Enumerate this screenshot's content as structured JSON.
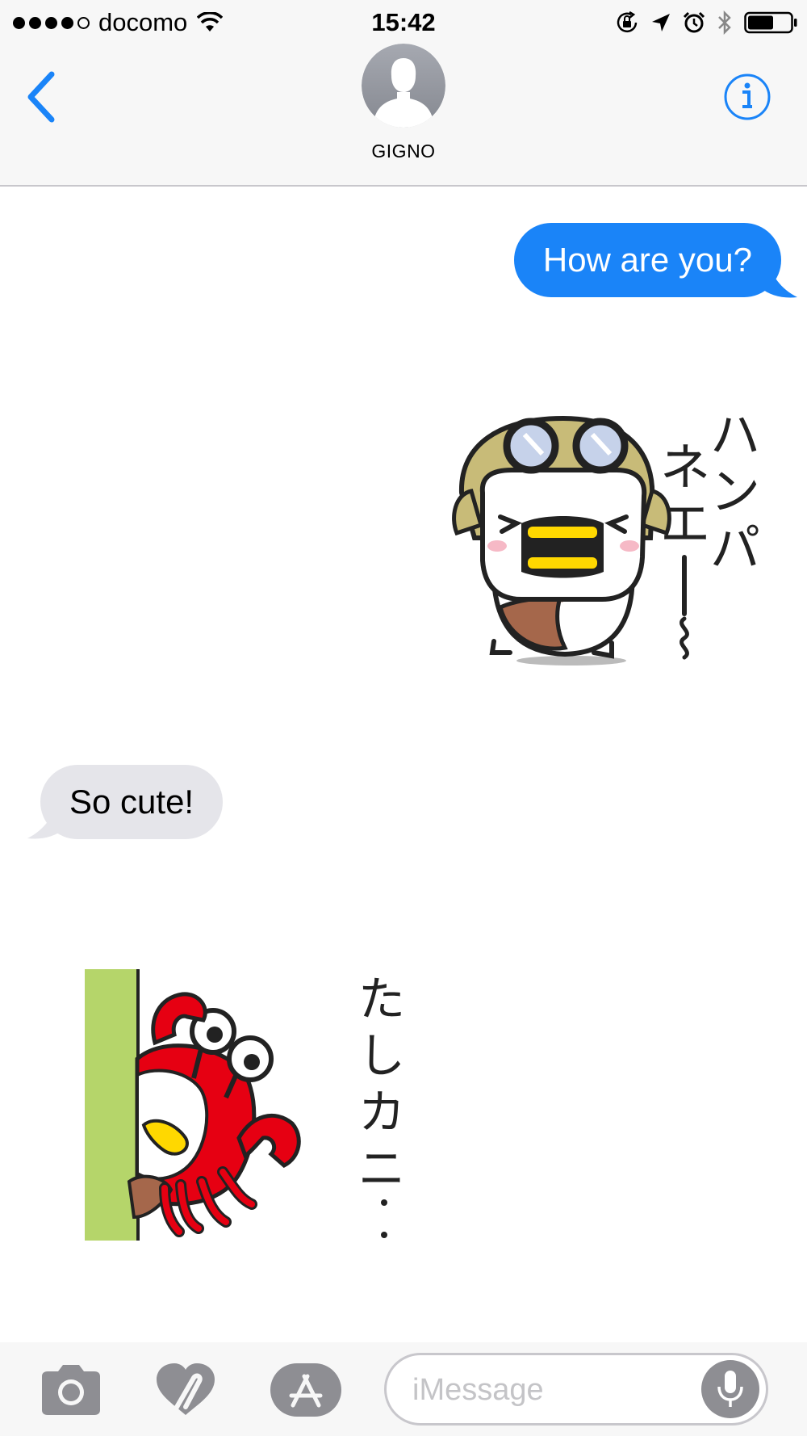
{
  "status_bar": {
    "carrier": "docomo",
    "time": "15:42",
    "signal_bars": 4,
    "icons": [
      "wifi-icon",
      "rotation-lock-icon",
      "location-icon",
      "alarm-icon",
      "bluetooth-icon",
      "battery-icon"
    ],
    "battery_level": 0.6
  },
  "header": {
    "contact_name": "GIGNO",
    "back_icon": "chevron-left-icon",
    "info_icon": "info-icon"
  },
  "colors": {
    "accent": "#1a84f8",
    "incoming_bubble": "#e5e5ea",
    "bar_background": "#f7f7f7"
  },
  "messages": [
    {
      "direction": "outgoing",
      "type": "text",
      "text": "How are you?"
    },
    {
      "direction": "outgoing",
      "type": "sticker",
      "caption": "ハンパネエー〜"
    },
    {
      "direction": "incoming",
      "type": "text",
      "text": "So cute!"
    },
    {
      "direction": "incoming",
      "type": "sticker",
      "caption": "たしカニ・・"
    }
  ],
  "input_bar": {
    "placeholder": "iMessage",
    "value": "",
    "icons": [
      "camera-icon",
      "digital-touch-icon",
      "app-store-icon",
      "microphone-icon"
    ]
  }
}
